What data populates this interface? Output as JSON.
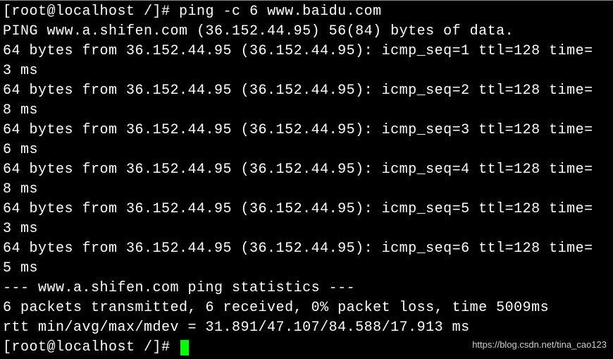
{
  "terminal": {
    "prompt": "[root@localhost /]# ",
    "command": "ping -c 6 www.baidu.com",
    "ping_header": "PING www.a.shifen.com (36.152.44.95) 56(84) bytes of data.",
    "replies": [
      {
        "line1": "64 bytes from 36.152.44.95 (36.152.44.95): icmp_seq=1 ttl=128 time=",
        "line2": "3 ms"
      },
      {
        "line1": "64 bytes from 36.152.44.95 (36.152.44.95): icmp_seq=2 ttl=128 time=",
        "line2": "8 ms"
      },
      {
        "line1": "64 bytes from 36.152.44.95 (36.152.44.95): icmp_seq=3 ttl=128 time=",
        "line2": "6 ms"
      },
      {
        "line1": "64 bytes from 36.152.44.95 (36.152.44.95): icmp_seq=4 ttl=128 time=",
        "line2": "8 ms"
      },
      {
        "line1": "64 bytes from 36.152.44.95 (36.152.44.95): icmp_seq=5 ttl=128 time=",
        "line2": "3 ms"
      },
      {
        "line1": "64 bytes from 36.152.44.95 (36.152.44.95): icmp_seq=6 ttl=128 time=",
        "line2": "5 ms"
      }
    ],
    "blank": "",
    "stats_header": "--- www.a.shifen.com ping statistics ---",
    "stats_line1": "6 packets transmitted, 6 received, 0% packet loss, time 5009ms",
    "stats_line2": "rtt min/avg/max/mdev = 31.891/47.107/84.588/17.913 ms",
    "prompt2": "[root@localhost /]# "
  },
  "watermark": "https://blog.csdn.net/tina_cao123"
}
